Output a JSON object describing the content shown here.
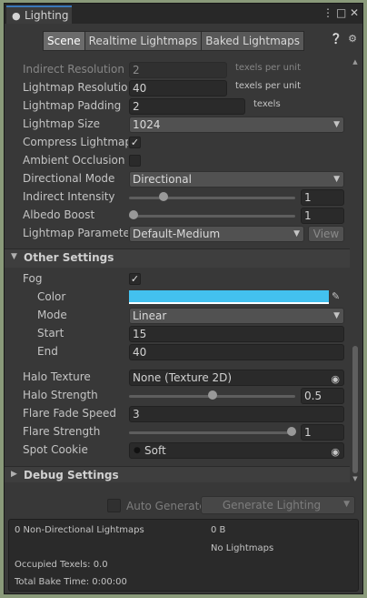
{
  "window": {
    "tab_title": "Lighting",
    "icons": [
      "kebab-menu-icon",
      "maximize-icon",
      "close-icon"
    ]
  },
  "tabs": [
    {
      "label": "Scene",
      "active": true
    },
    {
      "label": "Realtime Lightmaps",
      "active": false
    },
    {
      "label": "Baked Lightmaps",
      "active": false
    }
  ],
  "lightmapping": {
    "indirect_resolution": {
      "label": "Indirect Resolution",
      "value": "2",
      "unit": "texels per unit"
    },
    "lightmap_resolution": {
      "label": "Lightmap Resolution",
      "value": "40",
      "unit": "texels per unit"
    },
    "lightmap_padding": {
      "label": "Lightmap Padding",
      "value": "2",
      "unit": "texels"
    },
    "lightmap_size": {
      "label": "Lightmap Size",
      "value": "1024"
    },
    "compress_lightmaps": {
      "label": "Compress Lightmaps",
      "checked": true
    },
    "ambient_occlusion": {
      "label": "Ambient Occlusion",
      "checked": false
    },
    "directional_mode": {
      "label": "Directional Mode",
      "value": "Directional"
    },
    "indirect_intensity": {
      "label": "Indirect Intensity",
      "value": "1",
      "slider": 0.2
    },
    "albedo_boost": {
      "label": "Albedo Boost",
      "value": "1",
      "slider": 0.0
    },
    "lightmap_parameters": {
      "label": "Lightmap Parameter",
      "value": "Default-Medium",
      "view_label": "View"
    }
  },
  "other_settings": {
    "title": "Other Settings",
    "fog": {
      "label": "Fog",
      "checked": true
    },
    "color": {
      "label": "Color",
      "value": "#43c1ef"
    },
    "mode": {
      "label": "Mode",
      "value": "Linear"
    },
    "start": {
      "label": "Start",
      "value": "15"
    },
    "end": {
      "label": "End",
      "value": "40"
    },
    "halo_texture": {
      "label": "Halo Texture",
      "value": "None (Texture 2D)"
    },
    "halo_strength": {
      "label": "Halo Strength",
      "value": "0.5",
      "slider": 0.5
    },
    "flare_fade_speed": {
      "label": "Flare Fade Speed",
      "value": "3"
    },
    "flare_strength": {
      "label": "Flare Strength",
      "value": "1",
      "slider": 1.0
    },
    "spot_cookie": {
      "label": "Spot Cookie",
      "value": "Soft"
    }
  },
  "debug_settings": {
    "title": "Debug Settings"
  },
  "generate": {
    "auto_generate_label": "Auto Generate",
    "generate_button_label": "Generate Lighting"
  },
  "stats": {
    "non_directional": "0 Non-Directional Lightmaps",
    "size": "0 B",
    "no_lightmaps": "No Lightmaps",
    "occupied_texels": "Occupied Texels: 0.0",
    "total_bake_time": "Total Bake Time: 0:00:00"
  },
  "colors": {
    "accent": "#3a79bb",
    "fog_color": "#43c1ef"
  }
}
